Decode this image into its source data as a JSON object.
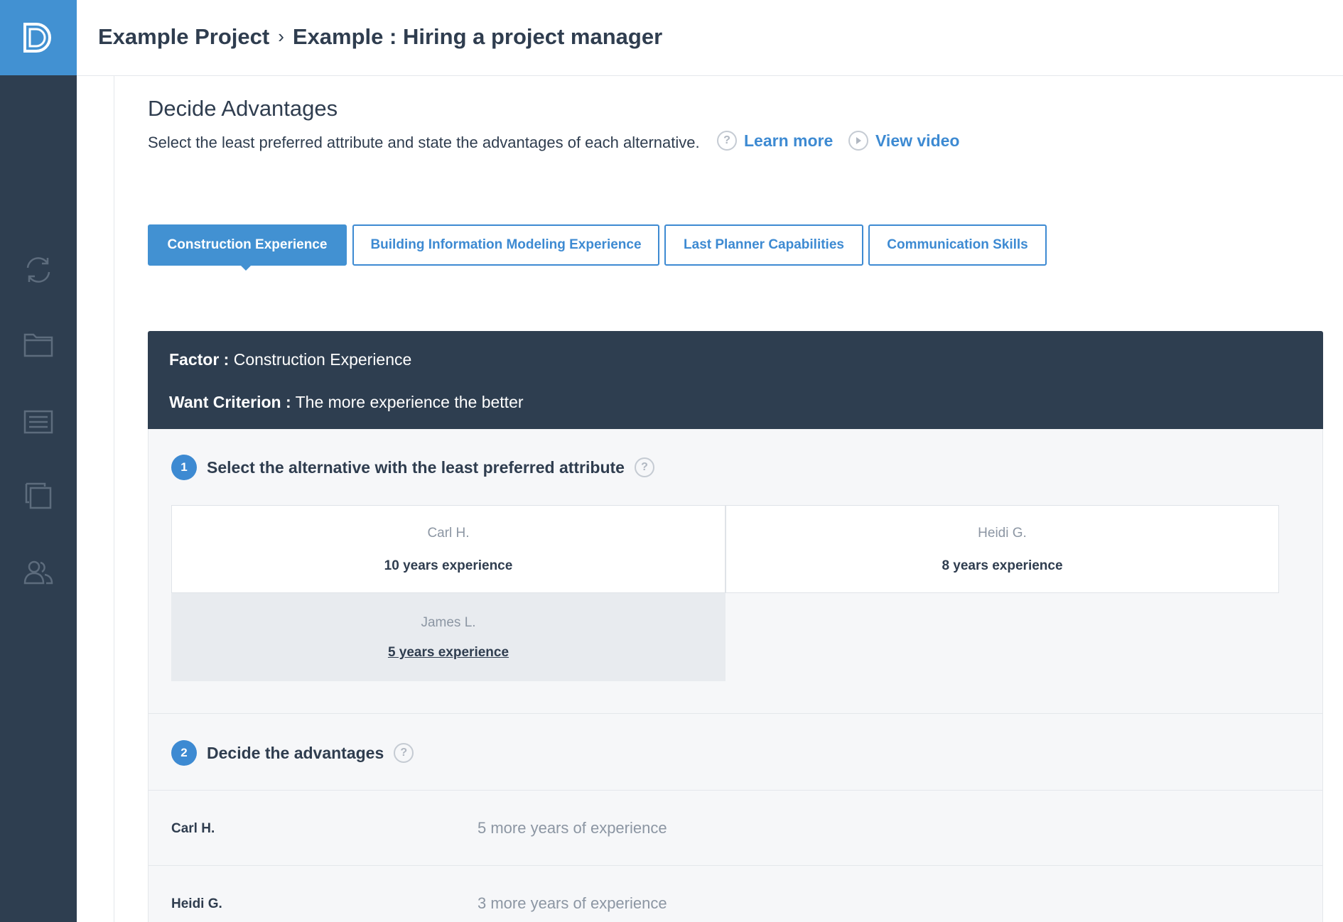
{
  "header": {
    "breadcrumb": [
      "Example Project",
      "Example : Hiring a project manager"
    ],
    "separator": "›"
  },
  "page": {
    "title": "Decide Advantages",
    "description": "Select the least preferred attribute and state the advantages of each alternative.",
    "learn_more": "Learn more",
    "view_video": "View video",
    "help_glyph": "?"
  },
  "tabs": [
    {
      "label": "Construction Experience",
      "active": true
    },
    {
      "label": "Building Information Modeling Experience",
      "active": false
    },
    {
      "label": "Last Planner Capabilities",
      "active": false
    },
    {
      "label": "Communication Skills",
      "active": false
    }
  ],
  "factor": {
    "factor_label": "Factor :",
    "factor_value": "Construction Experience",
    "criterion_label": "Want Criterion :",
    "criterion_value": "The more experience the better"
  },
  "step1": {
    "number": "1",
    "label": "Select the alternative with the least preferred attribute"
  },
  "alternatives": [
    {
      "name": "Carl H.",
      "attribute": "10 years experience",
      "selected": false
    },
    {
      "name": "Heidi G.",
      "attribute": "8 years experience",
      "selected": false
    },
    {
      "name": "James L.",
      "attribute": "5 years experience",
      "selected": true
    }
  ],
  "step2": {
    "number": "2",
    "label": "Decide the advantages"
  },
  "advantages": [
    {
      "name": "Carl H.",
      "value": "5 more years of experience"
    },
    {
      "name": "Heidi G.",
      "value": "3 more years of experience"
    }
  ],
  "sidebar": {
    "icons": [
      "sync-icon",
      "folder-icon",
      "list-icon",
      "copy-icon",
      "users-icon"
    ]
  },
  "colors": {
    "accent": "#4291d2",
    "sidebar": "#2e3e50",
    "panel": "#f6f7f9"
  }
}
